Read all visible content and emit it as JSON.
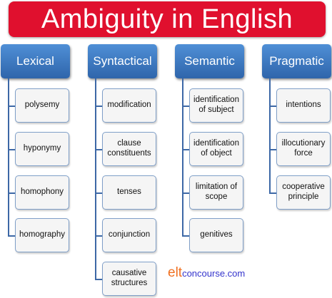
{
  "title": "Ambiguity in English",
  "categories": [
    {
      "label": "Lexical",
      "children": [
        "polysemy",
        "hyponymy",
        "homophony",
        "homography"
      ]
    },
    {
      "label": "Syntactical",
      "children": [
        "modification",
        "clause constituents",
        "tenses",
        "conjunction",
        "causative structures"
      ]
    },
    {
      "label": "Semantic",
      "children": [
        "identification of subject",
        "identification of object",
        "limitation of scope",
        "genitives"
      ]
    },
    {
      "label": "Pragmatic",
      "children": [
        "intentions",
        "illocutionary force",
        "cooperative principle"
      ]
    }
  ],
  "logo": {
    "elt": "elt",
    "rest": "concourse.com"
  },
  "colors": {
    "title": "#e0102e",
    "header": "#3a75c0",
    "logo_orange": "#f07020",
    "logo_blue": "#3333cc"
  }
}
